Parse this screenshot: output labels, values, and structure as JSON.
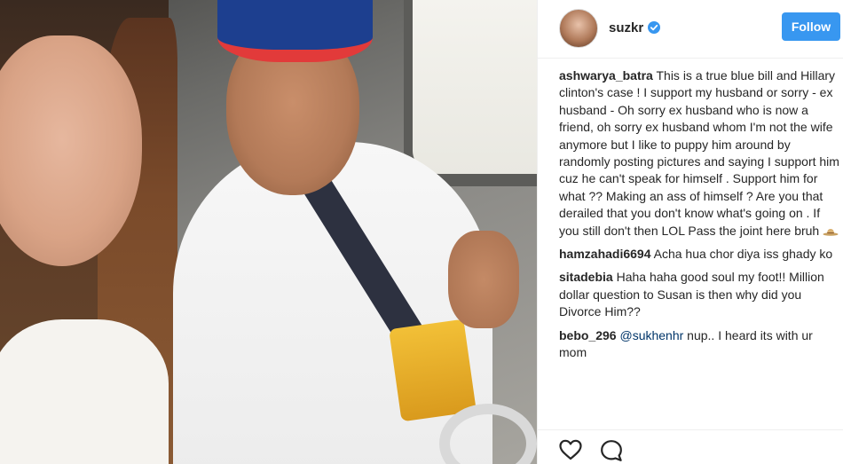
{
  "post": {
    "username": "suzkr",
    "verified_icon": "verified-badge-icon",
    "follow_label": "Follow",
    "photo_icon": "photo"
  },
  "comments": [
    {
      "author": "ashwarya_batra",
      "text": " This is a true blue bill and Hillary clinton's case ! I support my husband or sorry - ex husband - Oh sorry ex husband who is now a friend, oh sorry ex husband whom I'm not the wife anymore but I like to puppy him around by randomly posting pictures and saying I support him cuz he can't speak for himself . Support him for what ?? Making an ass of himself ? Are you that derailed that you don't know what's going on . If you still don't then LOL Pass the joint here bruh "
    },
    {
      "author": "hamzahadi6694",
      "text": " Acha hua chor diya iss ghady ko"
    },
    {
      "author": "sitadebia",
      "text": " Haha haha good soul my foot!! Million dollar question to Susan is then why did you Divorce Him??"
    },
    {
      "author": "bebo_296",
      "mention": " @sukhenhr",
      "text": " nup.. I heard its with ur mom"
    }
  ],
  "actions": {
    "like_icon": "heart-icon",
    "comment_icon": "comment-icon"
  },
  "colors": {
    "follow_button": "#3897f0",
    "verified": "#3897f0",
    "mention": "#003569"
  }
}
